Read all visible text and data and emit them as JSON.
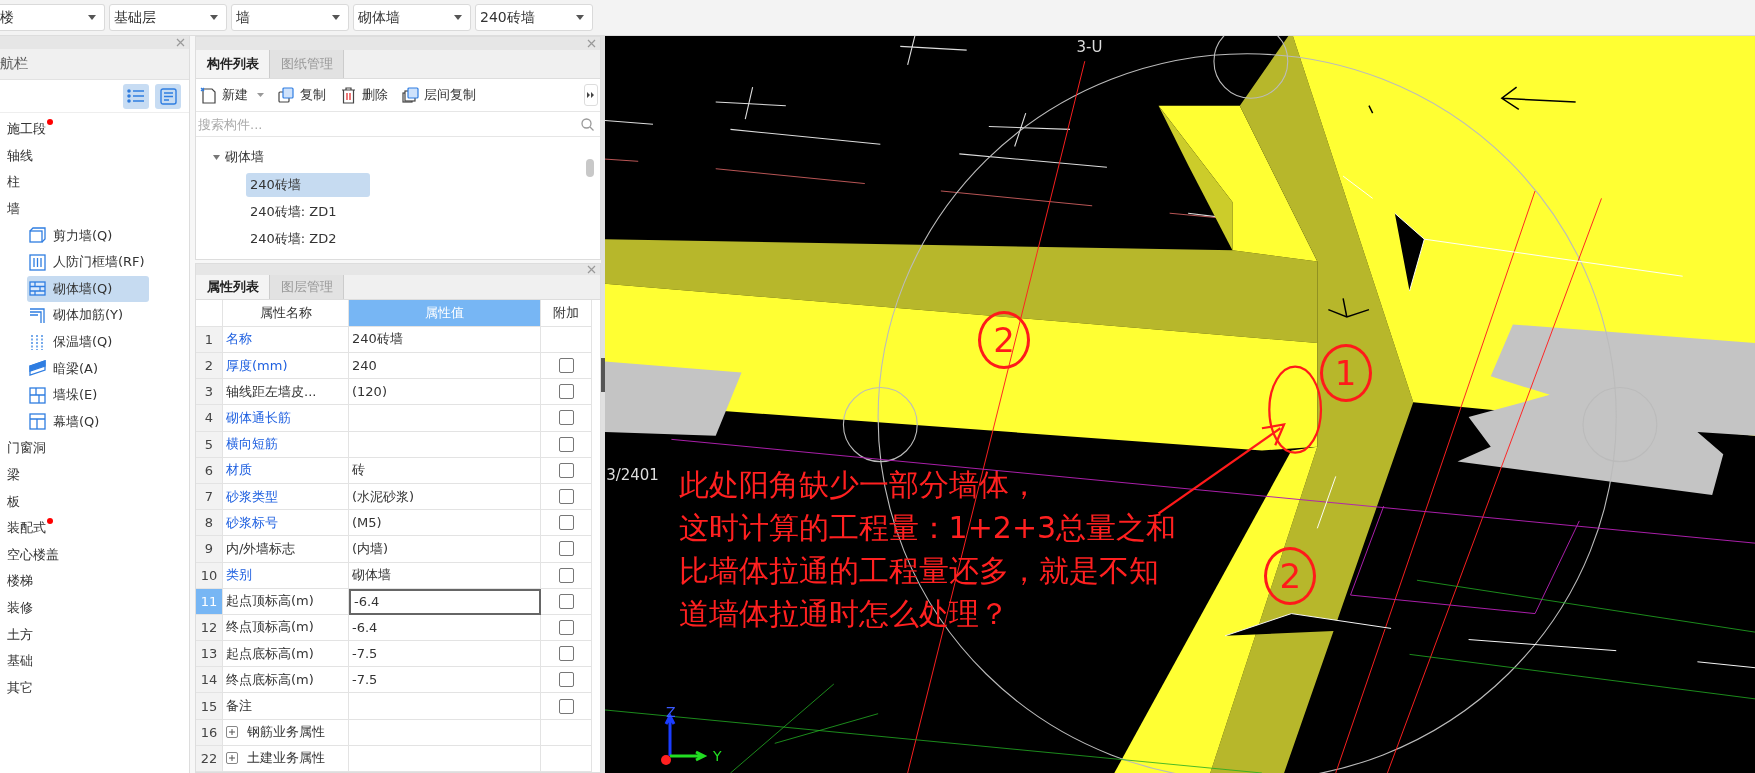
{
  "toolbar": {
    "dropdowns": [
      "楼",
      "基础层",
      "墙",
      "砌体墙",
      "240砖墙"
    ]
  },
  "nav": {
    "title": "航栏",
    "view_buttons": [
      {
        "kind": "list",
        "selected": true
      },
      {
        "kind": "detail",
        "selected": true
      }
    ],
    "items": [
      {
        "label": "施工段",
        "dot": true
      },
      {
        "label": "轴线",
        "dot": false
      },
      {
        "label": "柱",
        "dot": false
      },
      {
        "label": "墙",
        "dot": false,
        "children": [
          {
            "label": "剪力墙(Q)",
            "selected": false
          },
          {
            "label": "人防门框墙(RF)",
            "selected": false
          },
          {
            "label": "砌体墙(Q)",
            "selected": true
          },
          {
            "label": "砌体加筋(Y)",
            "selected": false
          },
          {
            "label": "保温墙(Q)",
            "selected": false
          },
          {
            "label": "暗梁(A)",
            "selected": false
          },
          {
            "label": "墙垛(E)",
            "selected": false
          },
          {
            "label": "幕墙(Q)",
            "selected": false
          }
        ]
      },
      {
        "label": "门窗洞",
        "dot": false
      },
      {
        "label": "梁",
        "dot": false
      },
      {
        "label": "板",
        "dot": false
      },
      {
        "label": "装配式",
        "dot": true
      },
      {
        "label": "空心楼盖",
        "dot": false
      },
      {
        "label": "楼梯",
        "dot": false
      },
      {
        "label": "装修",
        "dot": false
      },
      {
        "label": "土方",
        "dot": false
      },
      {
        "label": "基础",
        "dot": false
      },
      {
        "label": "其它",
        "dot": false
      }
    ]
  },
  "components": {
    "tabs": [
      {
        "label": "构件列表",
        "selected": true
      },
      {
        "label": "图纸管理",
        "selected": false
      }
    ],
    "actions": [
      {
        "label": "新建",
        "menu": true
      },
      {
        "label": "复制",
        "menu": false
      },
      {
        "label": "删除",
        "menu": false
      },
      {
        "label": "层间复制",
        "menu": false
      }
    ],
    "search": {
      "placeholder": "搜索构件..."
    },
    "tree": {
      "label": "砌体墙",
      "expanded": true,
      "children": [
        {
          "label": "240砖墙",
          "selected": true
        },
        {
          "label": "240砖墙: ZD1",
          "selected": false
        },
        {
          "label": "240砖墙: ZD2",
          "selected": false
        }
      ]
    }
  },
  "properties": {
    "tabs": [
      {
        "label": "属性列表",
        "selected": true
      },
      {
        "label": "图层管理",
        "selected": false
      }
    ],
    "columns": [
      "属性名称",
      "属性值",
      "附加"
    ],
    "rows": [
      {
        "no": "1",
        "name": "名称",
        "value": "240砖墙",
        "public": true,
        "kind": "plain",
        "selected": false
      },
      {
        "no": "2",
        "name": "厚度(mm)",
        "value": "240",
        "public": true,
        "kind": "check",
        "checked": false,
        "selected": false
      },
      {
        "no": "3",
        "name": "轴线距左墙皮...",
        "value": "(120)",
        "public": false,
        "kind": "check",
        "checked": false,
        "selected": false
      },
      {
        "no": "4",
        "name": "砌体通长筋",
        "value": "",
        "public": true,
        "kind": "check",
        "checked": false,
        "selected": false
      },
      {
        "no": "5",
        "name": "横向短筋",
        "value": "",
        "public": true,
        "kind": "check",
        "checked": false,
        "selected": false
      },
      {
        "no": "6",
        "name": "材质",
        "value": "砖",
        "public": true,
        "kind": "check",
        "checked": false,
        "selected": false
      },
      {
        "no": "7",
        "name": "砂浆类型",
        "value": "(水泥砂浆)",
        "public": true,
        "kind": "check",
        "checked": false,
        "selected": false
      },
      {
        "no": "8",
        "name": "砂浆标号",
        "value": "(M5)",
        "public": true,
        "kind": "check",
        "checked": false,
        "selected": false
      },
      {
        "no": "9",
        "name": "内/外墙标志",
        "value": "(内墙)",
        "public": false,
        "kind": "check",
        "checked": false,
        "selected": false
      },
      {
        "no": "10",
        "name": "类别",
        "value": "砌体墙",
        "public": true,
        "kind": "check",
        "checked": false,
        "selected": false
      },
      {
        "no": "11",
        "name": "起点顶标高(m)",
        "value": "-6.4",
        "public": false,
        "kind": "check",
        "checked": false,
        "selected": true
      },
      {
        "no": "12",
        "name": "终点顶标高(m)",
        "value": "-6.4",
        "public": false,
        "kind": "check",
        "checked": false,
        "selected": false
      },
      {
        "no": "13",
        "name": "起点底标高(m)",
        "value": "-7.5",
        "public": false,
        "kind": "check",
        "checked": false,
        "selected": false
      },
      {
        "no": "14",
        "name": "终点底标高(m)",
        "value": "-7.5",
        "public": false,
        "kind": "check",
        "checked": false,
        "selected": false
      },
      {
        "no": "15",
        "name": "备注",
        "value": "",
        "public": false,
        "kind": "check",
        "checked": false,
        "selected": false
      },
      {
        "no": "16",
        "name": "钢筋业务属性",
        "value": "",
        "kind": "group",
        "expanded": false,
        "selected": false
      },
      {
        "no": "22",
        "name": "土建业务属性",
        "value": "",
        "kind": "group",
        "expanded": false,
        "selected": false
      }
    ]
  },
  "viewport": {
    "grid_labels": [
      "3-U",
      "3/2401"
    ],
    "note": [
      "此处阳角缺少一部分墙体，",
      "这时计算的工程量：1+2+3总量之和",
      "比墙体拉通的工程量还多，就是不知",
      "道墙体拉通时怎么处理？"
    ],
    "marks": [
      "2",
      "1",
      "2"
    ],
    "axes": [
      "Z",
      "Y"
    ]
  }
}
